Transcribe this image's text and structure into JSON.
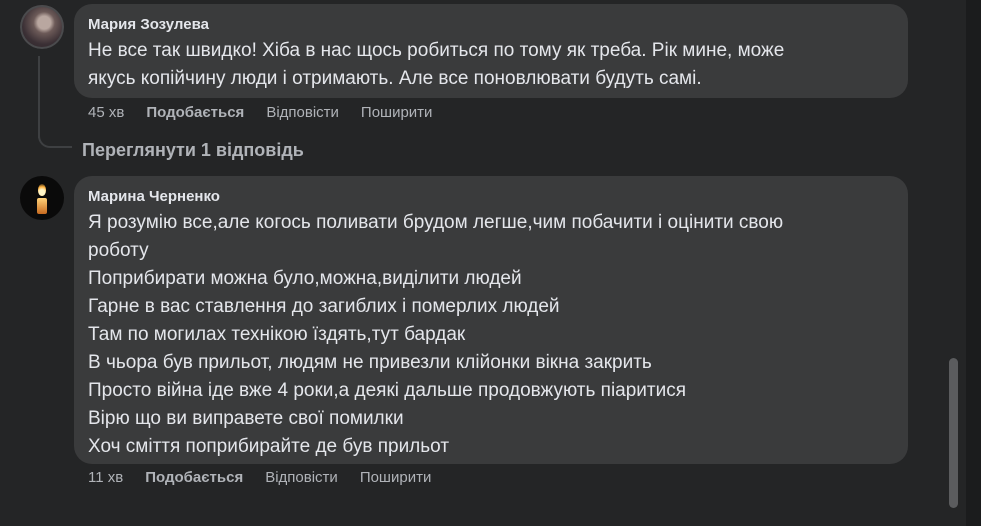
{
  "comments": [
    {
      "author": "Мария Зозулева",
      "lines": [
        "Не все так швидко! Хіба в нас щось робиться по тому як треба. Рік мине, може",
        "якусь копійчину люди і отримають. Але все поновлювати будуть самі."
      ],
      "time": "45 хв",
      "like_label": "Подобається",
      "reply_label": "Відповісти",
      "share_label": "Поширити",
      "view_replies": "Переглянути 1 відповідь"
    },
    {
      "author": "Марина Черненко",
      "lines": [
        "Я розумію все,але когось поливати брудом легше,чим побачити і оцінити свою",
        "роботу",
        "Поприбирати можна було,можна,виділити людей",
        "Гарне в вас ставлення до загиблих і померлих людей",
        "Там по могилах технікою їздять,тут бардак",
        "В чьора був прильот, людям не привезли клійонки вікна закрить",
        "Просто війна іде вже 4 роки,а деякі дальше продовжують піаритися",
        "Вірю що ви виправете свої помилки",
        "Хоч сміття поприбирайте де був прильот"
      ],
      "time": "11 хв",
      "like_label": "Подобається",
      "reply_label": "Відповісти",
      "share_label": "Поширити"
    }
  ],
  "colors": {
    "background": "#242526",
    "bubble": "#3a3b3c",
    "primary_text": "#e4e6eb",
    "secondary_text": "#b0b3b8"
  },
  "icons": [
    "avatar-photo",
    "candle-avatar"
  ]
}
